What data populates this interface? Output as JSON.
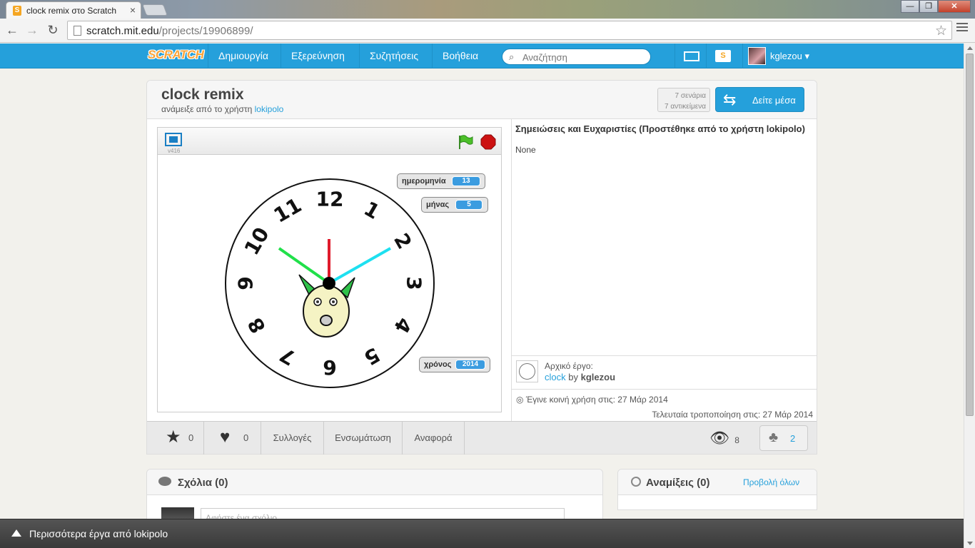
{
  "browser": {
    "tab_title": "clock remix στο Scratch",
    "tab_favicon": "S",
    "url_host": "scratch.mit.edu",
    "url_path": "/projects/19906899/",
    "win_minimize": "—",
    "win_maximize": "❐",
    "win_close": "✕"
  },
  "nav": {
    "logo": "SCRATCH",
    "create": "Δημιουργία",
    "explore": "Εξερεύνηση",
    "discuss": "Συζητήσεις",
    "help": "Βοήθεια",
    "search_placeholder": "Αναζήτηση",
    "stuff_icon_letter": "S",
    "username": "kglezou",
    "caret": "▾"
  },
  "project": {
    "title": "clock remix",
    "remixed_by_prefix": "ανάμειξε από το χρήστη",
    "remixed_by_user": "lokipolo",
    "scripts_count": "7 σενάρια",
    "sprites_count": "7 αντικείμενα",
    "see_inside": "Δείτε μέσα",
    "player_version": "v416",
    "notes_title": "Σημειώσεις και Ευχαριστίες (Προστέθηκε από το χρήστη lokipolo)",
    "notes_body": "None",
    "original_label": "Αρχικό έργο:",
    "original_project": "clock",
    "original_by": "by",
    "original_author": "kglezou",
    "shared_date": "Έγινε κοινή χρήση στις: 27 Μάρ 2014",
    "modified_date": "Τελευταία τροποποίηση στις: 27 Μάρ 2014"
  },
  "monitors": {
    "date_label": "ημερομηνία",
    "date_value": "13",
    "month_label": "μήνας",
    "month_value": "5",
    "year_label": "χρόνος",
    "year_value": "2014"
  },
  "clock_numbers": [
    "12",
    "1",
    "2",
    "3",
    "4",
    "5",
    "6",
    "7",
    "8",
    "9",
    "10",
    "11"
  ],
  "actions": {
    "favorites": "0",
    "loves": "0",
    "studios": "Συλλογές",
    "embed": "Ενσωμάτωση",
    "report": "Αναφορά",
    "views": "8",
    "remixes": "2"
  },
  "comments": {
    "title": "Σχόλια (0)",
    "placeholder": "Αφήστε ένα σχόλιο"
  },
  "remixes_panel": {
    "title": "Αναμίξεις (0)",
    "view_all": "Προβολή όλων"
  },
  "footer": {
    "more_by": "Περισσότερα έργα από lokipolo"
  },
  "colors": {
    "scratch_blue": "#25a0db",
    "hand_red": "#e01b2c",
    "hand_green": "#21e04a",
    "hand_cyan": "#1ee0f0"
  }
}
